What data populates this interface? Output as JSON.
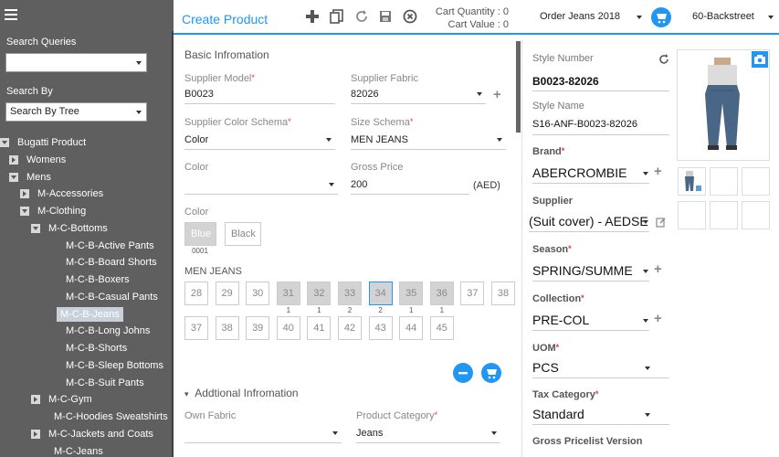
{
  "sidebar": {
    "search_queries_label": "Search Queries",
    "search_queries_value": "",
    "search_by_label": "Search By",
    "search_by_value": "Search By Tree",
    "tree": [
      {
        "label": "Bugatti Product",
        "level": 0,
        "state": "collapse"
      },
      {
        "label": "Womens",
        "level": 1,
        "state": "expand"
      },
      {
        "label": "Mens",
        "level": 1,
        "state": "collapse"
      },
      {
        "label": "M-Accessories",
        "level": 2,
        "state": "expand"
      },
      {
        "label": "M-Clothing",
        "level": 2,
        "state": "collapse"
      },
      {
        "label": "M-C-Bottoms",
        "level": 3,
        "state": "collapse"
      },
      {
        "label": "M-C-B-Active Pants",
        "level": 4,
        "state": "none"
      },
      {
        "label": "M-C-B-Board Shorts",
        "level": 4,
        "state": "none"
      },
      {
        "label": "M-C-B-Boxers",
        "level": 4,
        "state": "none"
      },
      {
        "label": "M-C-B-Casual Pants",
        "level": 4,
        "state": "none"
      },
      {
        "label": "M-C-B-Jeans",
        "level": 4,
        "state": "none",
        "selected": true
      },
      {
        "label": "M-C-B-Long Johns",
        "level": 4,
        "state": "none"
      },
      {
        "label": "M-C-B-Shorts",
        "level": 4,
        "state": "none"
      },
      {
        "label": "M-C-B-Sleep Bottoms",
        "level": 4,
        "state": "none"
      },
      {
        "label": "M-C-B-Suit Pants",
        "level": 4,
        "state": "none"
      },
      {
        "label": "M-C-Gym",
        "level": 3,
        "state": "expand"
      },
      {
        "label": "M-C-Hoodies Sweatshirts",
        "level": 3,
        "state": "none"
      },
      {
        "label": "M-C-Jackets and Coats",
        "level": 3,
        "state": "expand"
      },
      {
        "label": "M-C-Jeans",
        "level": 3,
        "state": "none"
      }
    ]
  },
  "header": {
    "title": "Create Product",
    "cart_quantity": "Cart Quantity : 0",
    "cart_value": "Cart Value : 0",
    "order": "Order Jeans 2018",
    "store": "60-Backstreet",
    "accent": "#2196f3"
  },
  "basic": {
    "title": "Basic Infromation",
    "supplier_model_label": "Supplier Model",
    "supplier_model_value": "B0023",
    "supplier_fabric_label": "Supplier Fabric",
    "supplier_fabric_value": "82026",
    "color_schema_label": "Supplier Color Schema",
    "color_schema_value": "Color",
    "size_schema_label": "Size Schema",
    "size_schema_value": "MEN JEANS",
    "color_label": "Color",
    "color_value": "",
    "gross_price_label": "Gross Price",
    "gross_price_value": "200",
    "currency": "(AED)",
    "color_section_label": "Color",
    "colors": [
      {
        "label": "Blue",
        "code": "0001",
        "selected": true
      },
      {
        "label": "Black",
        "code": "",
        "selected": false
      }
    ],
    "size_schema_name": "MEN JEANS",
    "sizes_row1": [
      {
        "label": "28",
        "qty": "",
        "state": "empty"
      },
      {
        "label": "29",
        "qty": "",
        "state": "empty"
      },
      {
        "label": "30",
        "qty": "",
        "state": "empty"
      },
      {
        "label": "31",
        "qty": "1",
        "state": "filled"
      },
      {
        "label": "32",
        "qty": "1",
        "state": "filled"
      },
      {
        "label": "33",
        "qty": "2",
        "state": "filled"
      },
      {
        "label": "34",
        "qty": "2",
        "state": "active"
      },
      {
        "label": "35",
        "qty": "1",
        "state": "filled"
      },
      {
        "label": "36",
        "qty": "1",
        "state": "filled"
      },
      {
        "label": "37",
        "qty": "",
        "state": "empty"
      },
      {
        "label": "38",
        "qty": "",
        "state": "empty"
      }
    ],
    "sizes_row2": [
      {
        "label": "37",
        "qty": "",
        "state": "empty"
      },
      {
        "label": "38",
        "qty": "",
        "state": "empty"
      },
      {
        "label": "39",
        "qty": "",
        "state": "empty"
      },
      {
        "label": "40",
        "qty": "",
        "state": "empty"
      },
      {
        "label": "41",
        "qty": "",
        "state": "empty"
      },
      {
        "label": "42",
        "qty": "",
        "state": "empty"
      },
      {
        "label": "43",
        "qty": "",
        "state": "empty"
      },
      {
        "label": "44",
        "qty": "",
        "state": "empty"
      },
      {
        "label": "45",
        "qty": "",
        "state": "empty"
      }
    ]
  },
  "additional": {
    "title": "Addtional Infromation",
    "own_fabric_label": "Own Fabric",
    "own_fabric_value": "",
    "product_category_label": "Product Category",
    "product_category_value": "Jeans"
  },
  "right": {
    "style_number_label": "Style Number",
    "style_number_value": "B0023-82026",
    "style_name_label": "Style Name",
    "style_name_value": "S16-ANF-B0023-82026",
    "brand_label": "Brand",
    "brand_value": "ABERCROMBIE",
    "supplier_label": "Supplier",
    "supplier_value": "(Suit cover) - AEDSE",
    "season_label": "Season",
    "season_value": "SPRING/SUMME",
    "collection_label": "Collection",
    "collection_value": "PRE-COL",
    "uom_label": "UOM",
    "uom_value": "PCS",
    "tax_label": "Tax Category",
    "tax_value": "Standard",
    "gross_pricelist_label": "Gross Pricelist Version"
  }
}
